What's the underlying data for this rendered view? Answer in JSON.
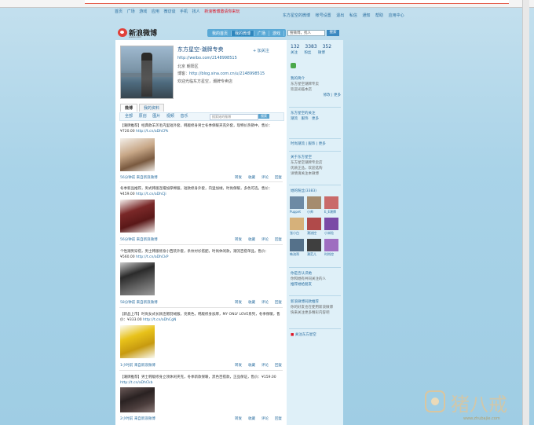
{
  "topnav": {
    "items": [
      "首页",
      "广场",
      "游戏",
      "应用",
      "微访谈",
      "手机",
      "找人"
    ],
    "hot": "新浪微博邀请你来玩"
  },
  "toplinks": [
    "东方星空的微博",
    "帐号设置",
    "退出",
    "私信",
    "通知",
    "帮助",
    "应用中心"
  ],
  "logo": {
    "text": "新浪微博",
    "url": "weibo.com"
  },
  "nav_tabs": [
    "我的首页",
    "我的微博",
    "广场",
    "游戏"
  ],
  "search": {
    "placeholder": "搜微博，找人",
    "button": "搜索"
  },
  "profile": {
    "name": "东方星空-潮牌专卖",
    "follow_label": "+ 加关注",
    "weibo_link": "http://weibo.com/2148998515",
    "location": "北京 朝阳区",
    "blog_label": "博客：",
    "blog_link": "http://blog.sina.com.cn/u/2148998515",
    "bio": "欢迎光临东方星空，潮牌专卖店"
  },
  "profile_tabs": [
    "微博",
    "我的资料"
  ],
  "filter": {
    "items": [
      "全部",
      "原创",
      "图片",
      "视频",
      "音乐"
    ],
    "search_placeholder": "搜索她的微博",
    "search_button": "搜索"
  },
  "posts": [
    {
      "text": "【潮牌推荐】经典款羊羔毛内里短外套，韩版修身男士冬季保暖夹克外套，现特价热销中，售价：¥720.00",
      "link": "http://t.cn/aDhCPk",
      "time": "56分钟前",
      "source": "来自新浪微博",
      "actions": [
        "转发",
        "收藏",
        "评论"
      ],
      "reply": "回复"
    },
    {
      "text": "冬季新品推荐，男式韩版连帽加厚棉服，短款修身外套，内里加绒，时尚保暖，多色可选，售价：¥459.00",
      "link": "http://t.cn/aDhCJi",
      "time": "56分钟前",
      "source": "来自新浪微博",
      "actions": [
        "转发",
        "收藏",
        "评论"
      ],
      "reply": "回复"
    },
    {
      "text": "个性潮男穿搭，男士韩版修身小西装外套，条纹衬衫搭配，时尚休闲款，潮流百搭单品，售价：¥560.00",
      "link": "http://t.cn/aDhCkP",
      "time": "58分钟前",
      "source": "来自新浪微博",
      "actions": [
        "转发",
        "收藏",
        "评论"
      ],
      "reply": "回复"
    },
    {
      "text": "【新品上市】时尚女式长款连帽羽绒服，亮黄色，韩版修身加厚，MY ONLY LOVE系列，冬季保暖，售价：¥333.00",
      "link": "http://t.cn/aDhCgN",
      "time": "1小时前",
      "source": "来自新浪微博",
      "actions": [
        "转发",
        "收藏",
        "评论"
      ],
      "reply": "回复"
    },
    {
      "text": "【潮牌推荐】男士韩版修身立领休闲夹克，冬季新款保暖，黑色百搭款，正品保证，售价：¥159.00",
      "link": "http://t.cn/aDhCkb",
      "time": "2小时前",
      "source": "来自新浪微博",
      "actions": [
        "转发",
        "收藏",
        "评论"
      ],
      "reply": "回复"
    }
  ],
  "side": {
    "stats_numbers": [
      "132",
      "3383",
      "352"
    ],
    "stats_labels": [
      "关注",
      "粉丝",
      "微博"
    ],
    "intro_title": "我的简介",
    "intro_lines": [
      "东方星空潮牌专卖",
      "欢迎光临本店"
    ],
    "intro_links": [
      "修改",
      "更多"
    ],
    "groups_title": "东方星空的关注",
    "groups_links": [
      "潮流",
      "服饰",
      "更多"
    ],
    "tags_title": "更多",
    "tag_links": [
      "时尚潮流",
      "服饰",
      "更多"
    ],
    "hot_title": "关于东方星空",
    "hot_lines": [
      "东方星空潮牌专卖店",
      "优质正品，欢迎选购",
      "详情请关注本微博"
    ],
    "fans_title": "她的粉丝(3383)",
    "fan_names": [
      "Puppet",
      "小帅",
      "E_E潮牌",
      "张小白",
      "潮流控",
      "小米粒",
      "韩流哥",
      "潮范儿",
      "时尚控"
    ],
    "recommend_title": "你是否认识她",
    "recommend_lines": [
      "你和她有共同关注的人"
    ],
    "recommend_link": "推荐她给朋友",
    "report_title": "新浪微博同款推荐",
    "report_lines": [
      "你的好友也在使用新浪微博",
      "快来关注更多精彩内容吧"
    ],
    "footer_link": "关注东方星空"
  },
  "colors": {
    "accent": "#2a6ea0",
    "hot": "#dd1122",
    "nav": "#5aa9d6"
  },
  "watermark": {
    "brand": "猪八戒",
    "url": "www.zhubajie.com"
  }
}
